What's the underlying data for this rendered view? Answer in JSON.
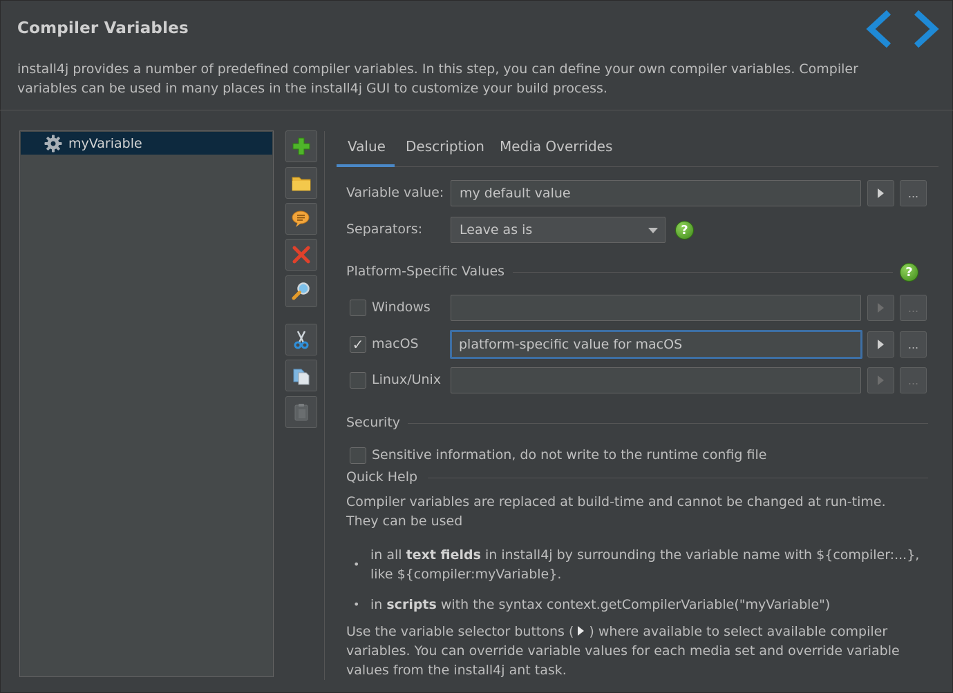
{
  "header": {
    "title": "Compiler Variables",
    "intro": "install4j provides a number of predefined compiler variables. In this step, you can define your own compiler variables. Compiler variables can be used in many places in the install4j GUI to customize your build process."
  },
  "variables": [
    {
      "name": "myVariable",
      "icon": "gear-icon"
    }
  ],
  "toolbar": {
    "buttons": [
      {
        "name": "add-icon"
      },
      {
        "name": "folder-icon"
      },
      {
        "name": "comment-icon"
      },
      {
        "name": "delete-icon"
      },
      {
        "name": "search-icon"
      },
      {
        "name": "cut-icon"
      },
      {
        "name": "copy-icon"
      },
      {
        "name": "paste-icon"
      }
    ]
  },
  "tabs": [
    {
      "label": "Value",
      "active": true
    },
    {
      "label": "Description",
      "active": false
    },
    {
      "label": "Media Overrides",
      "active": false
    }
  ],
  "value_tab": {
    "variable_value_label": "Variable value:",
    "variable_value": "my default value",
    "separators_label": "Separators:",
    "separators_value": "Leave as is",
    "ellipsis": "...",
    "help_glyph": "?",
    "platform_section": "Platform-Specific Values",
    "platforms": [
      {
        "label": "Windows",
        "checked": false,
        "value": ""
      },
      {
        "label": "macOS",
        "checked": true,
        "value": "platform-specific value for macOS"
      },
      {
        "label": "Linux/Unix",
        "checked": false,
        "value": ""
      }
    ],
    "check_glyph": "✓",
    "security_section": "Security",
    "sensitive_label": "Sensitive information, do not write to the runtime config file",
    "quick_help_section": "Quick Help"
  },
  "quick_help": {
    "intro": "Compiler variables are replaced at build-time and cannot be changed at run-time. They can be used",
    "bullet_glyph": "•",
    "b1_pre": "in all ",
    "b1_bold": "text fields",
    "b1_post": " in install4j by surrounding the variable name with ${compiler:...}, like ${compiler:myVariable}.",
    "b2_pre": "in ",
    "b2_bold": "scripts",
    "b2_post": " with the syntax context.getCompilerVariable(\"myVariable\")",
    "outro_pre": "Use the variable selector buttons (",
    "outro_post": ") where available to select available compiler variables. You can override variable values for each media set and override variable values from the install4j ant task."
  },
  "colors": {
    "background": "#3c3f41",
    "selection": "#0d293e",
    "accent": "#4a88c7",
    "nav_arrow": "#1f8ad6"
  }
}
